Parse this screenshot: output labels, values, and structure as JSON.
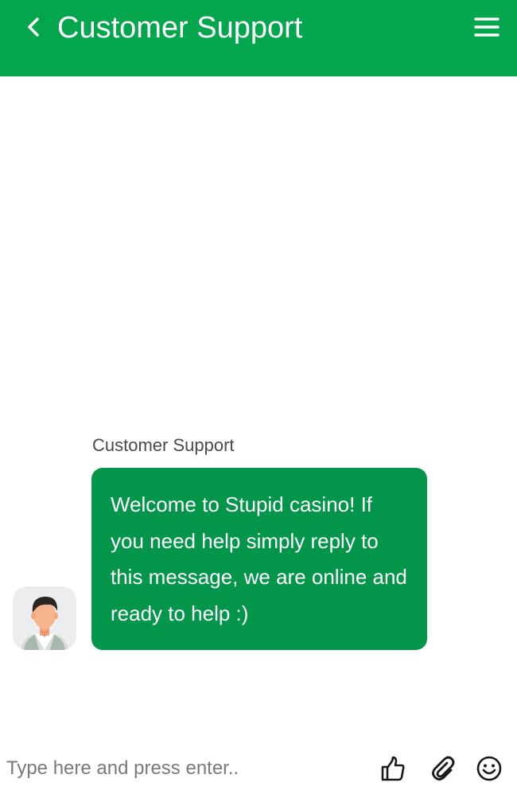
{
  "header": {
    "title": "Customer Support",
    "back_icon": "chevron-left-icon",
    "menu_icon": "hamburger-menu-icon",
    "background_color": "#03a64d"
  },
  "conversation": {
    "messages": [
      {
        "sender": "Customer Support",
        "text": "Welcome to Stupid casino! If you need help simply reply to this message, we are online and ready to help :)",
        "bubble_color": "#03964a",
        "avatar": "support-agent-avatar"
      }
    ]
  },
  "composer": {
    "placeholder": "Type here and press enter..",
    "value": "",
    "actions": [
      {
        "name": "like",
        "icon": "thumbs-up-icon"
      },
      {
        "name": "attach",
        "icon": "paperclip-icon"
      },
      {
        "name": "emoji",
        "icon": "smiley-icon"
      }
    ]
  }
}
